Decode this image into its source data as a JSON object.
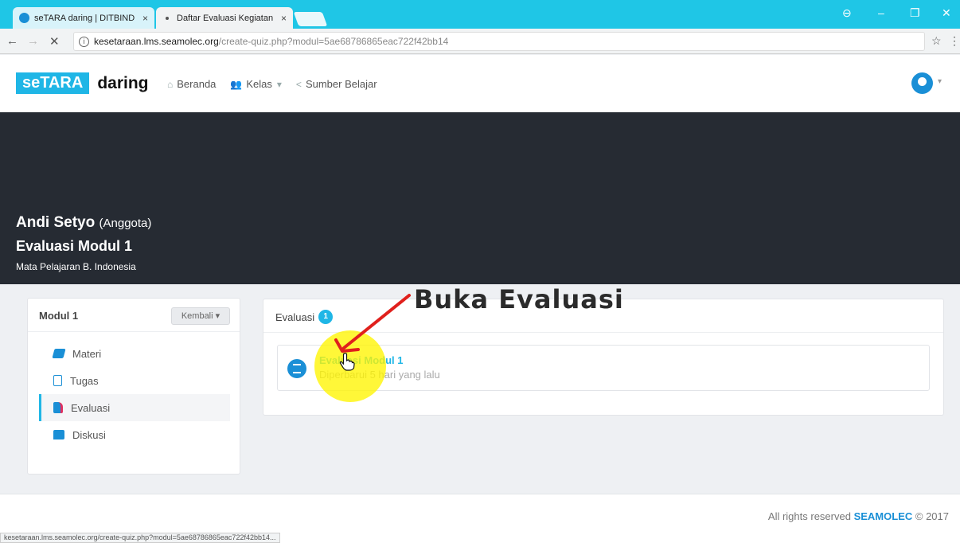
{
  "browser": {
    "tabs": [
      {
        "title": "seTARA daring | DITBIND",
        "close": "×"
      },
      {
        "title": "Daftar Evaluasi Kegiatan",
        "close": "×"
      }
    ],
    "window_controls": {
      "profile": "⊖",
      "minimize": "–",
      "restore": "❐",
      "close": "✕"
    },
    "nav": {
      "back": "←",
      "forward": "→",
      "stop": "✕",
      "star": "☆",
      "menu": "⋮"
    },
    "url_host": "kesetaraan.lms.seamolec.org",
    "url_path": "/create-quiz.php?modul=5ae68786865eac722f42bb14",
    "status_url": "kesetaraan.lms.seamolec.org/create-quiz.php?modul=5ae68786865eac722f42bb14..."
  },
  "site": {
    "logo_pill": "seTARA",
    "logo_word": "daring",
    "nav": [
      {
        "label": "Beranda",
        "icon": "home-icon"
      },
      {
        "label": "Kelas",
        "icon": "users-icon"
      },
      {
        "label": "Sumber Belajar",
        "icon": "share-icon"
      }
    ]
  },
  "hero": {
    "user_name": "Andi Setyo",
    "user_role": "(Anggota)",
    "evaluation_title": "Evaluasi Modul 1",
    "subject": "Mata Pelajaran B. Indonesia"
  },
  "sidebar": {
    "title": "Modul 1",
    "back_button": "Kembali",
    "items": [
      {
        "label": "Materi",
        "icon": "book-icon",
        "color": "#1a8fd6"
      },
      {
        "label": "Tugas",
        "icon": "document-icon",
        "color": "#1a8fd6"
      },
      {
        "label": "Evaluasi",
        "icon": "clipboard-icon",
        "color": "#1a8fd6"
      },
      {
        "label": "Diskusi",
        "icon": "chat-icon",
        "color": "#1a8fd6"
      }
    ],
    "active_index": 2
  },
  "evaluasi": {
    "heading": "Evaluasi",
    "count": "1",
    "items": [
      {
        "title": "Evaluasi Modul 1",
        "subtitle": "Diperbarui 5 hari yang lalu"
      }
    ]
  },
  "annotation": {
    "text": "Buka Evaluasi"
  },
  "footer": {
    "prefix": "All rights reserved",
    "brand": "SEAMOLEC",
    "suffix": "© 2017"
  },
  "colors": {
    "accent": "#1fb6e6",
    "brand_blue": "#1a8fd6",
    "hero_bg": "#262b33",
    "highlight": "#fff500"
  }
}
